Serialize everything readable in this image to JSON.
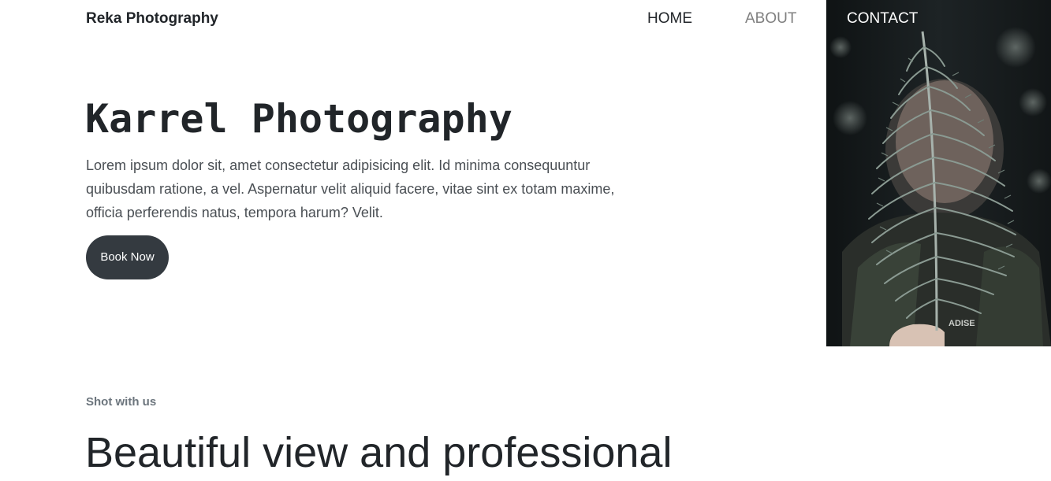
{
  "nav": {
    "brand": "Reka Photography",
    "links": [
      "HOME",
      "ABOUT",
      "CONTACT"
    ]
  },
  "hero": {
    "title": "Karrel Photography",
    "text": "Lorem ipsum dolor sit, amet consectetur adipisicing elit. Id minima consequuntur quibusdam ratione, a vel. Aspernatur velit aliquid facere, vitae sint ex totam maxime, officia perferendis natus, tempora harum? Velit.",
    "button_label": "Book Now",
    "photo_shirt_text": "ADISE"
  },
  "section": {
    "eyebrow": "Shot with us",
    "heading": "Beautiful view and professional"
  },
  "colors": {
    "button_bg": "#343a40",
    "photo_bg": "#1a1f21",
    "fern": "#8a9a92",
    "nav_muted": "#808080"
  }
}
